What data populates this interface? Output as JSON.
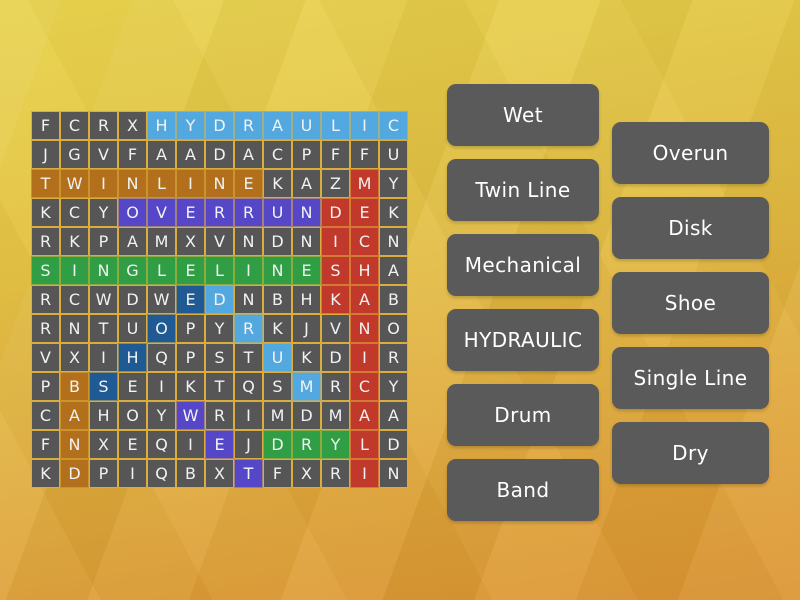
{
  "app": {
    "type": "word-search-puzzle",
    "background_top_color": "#e8d24c",
    "background_bottom_color": "#dc9432"
  },
  "grid": {
    "rows": 13,
    "cols": 13,
    "cell_background": "#565656",
    "cell_text_color": "#f2f2f2",
    "letters": [
      [
        "F",
        "C",
        "R",
        "X",
        "H",
        "Y",
        "D",
        "R",
        "A",
        "U",
        "L",
        "I",
        "C"
      ],
      [
        "J",
        "G",
        "V",
        "F",
        "A",
        "A",
        "D",
        "A",
        "C",
        "P",
        "F",
        "F",
        "U"
      ],
      [
        "T",
        "W",
        "I",
        "N",
        "L",
        "I",
        "N",
        "E",
        "K",
        "A",
        "Z",
        "M",
        "Y"
      ],
      [
        "K",
        "C",
        "Y",
        "O",
        "V",
        "E",
        "R",
        "R",
        "U",
        "N",
        "D",
        "E",
        "K"
      ],
      [
        "R",
        "K",
        "P",
        "A",
        "M",
        "X",
        "V",
        "N",
        "D",
        "N",
        "I",
        "C",
        "N"
      ],
      [
        "S",
        "I",
        "N",
        "G",
        "L",
        "E",
        "L",
        "I",
        "N",
        "E",
        "S",
        "H",
        "A"
      ],
      [
        "R",
        "C",
        "W",
        "D",
        "W",
        "E",
        "D",
        "N",
        "B",
        "H",
        "K",
        "A",
        "B"
      ],
      [
        "R",
        "N",
        "T",
        "U",
        "O",
        "P",
        "Y",
        "R",
        "K",
        "J",
        "V",
        "N",
        "O"
      ],
      [
        "V",
        "X",
        "I",
        "H",
        "Q",
        "P",
        "S",
        "T",
        "U",
        "K",
        "D",
        "I",
        "R"
      ],
      [
        "P",
        "B",
        "S",
        "E",
        "I",
        "K",
        "T",
        "Q",
        "S",
        "M",
        "R",
        "C",
        "Y"
      ],
      [
        "C",
        "A",
        "H",
        "O",
        "Y",
        "W",
        "R",
        "I",
        "M",
        "D",
        "M",
        "A",
        "A"
      ],
      [
        "F",
        "N",
        "X",
        "E",
        "Q",
        "I",
        "E",
        "J",
        "D",
        "R",
        "Y",
        "L",
        "D"
      ],
      [
        "K",
        "D",
        "P",
        "I",
        "Q",
        "B",
        "X",
        "T",
        "F",
        "X",
        "R",
        "I",
        "N"
      ]
    ],
    "highlights": [
      [
        "",
        "",
        "",
        "",
        "blue",
        "blue",
        "blue",
        "blue",
        "blue",
        "blue",
        "blue",
        "blue",
        "blue"
      ],
      [
        "",
        "",
        "",
        "",
        "",
        "",
        "",
        "",
        "",
        "",
        "",
        "",
        ""
      ],
      [
        "brown",
        "brown",
        "brown",
        "brown",
        "brown",
        "brown",
        "brown",
        "brown",
        "",
        "",
        "",
        "red",
        ""
      ],
      [
        "",
        "",
        "",
        "purple",
        "purple",
        "purple",
        "purple",
        "purple",
        "purple",
        "purple",
        "red",
        "red",
        ""
      ],
      [
        "",
        "",
        "",
        "",
        "",
        "",
        "",
        "",
        "",
        "",
        "red",
        "red",
        ""
      ],
      [
        "green",
        "green",
        "green",
        "green",
        "green",
        "green",
        "green",
        "green",
        "green",
        "green",
        "red",
        "red",
        ""
      ],
      [
        "",
        "",
        "",
        "",
        "",
        "navy",
        "blue",
        "",
        "",
        "",
        "red",
        "red",
        ""
      ],
      [
        "",
        "",
        "",
        "",
        "navy",
        "",
        "",
        "blue",
        "",
        "",
        "",
        "red",
        ""
      ],
      [
        "",
        "",
        "",
        "navy",
        "",
        "",
        "",
        "",
        "blue",
        "",
        "",
        "red",
        ""
      ],
      [
        "",
        "brown",
        "navy",
        "",
        "",
        "",
        "",
        "",
        "",
        "blue",
        "",
        "red",
        ""
      ],
      [
        "",
        "brown",
        "",
        "",
        "",
        "purple",
        "",
        "",
        "",
        "",
        "",
        "red",
        ""
      ],
      [
        "",
        "brown",
        "",
        "",
        "",
        "",
        "purple",
        "",
        "green",
        "green",
        "green",
        "red",
        ""
      ],
      [
        "",
        "brown",
        "",
        "",
        "",
        "",
        "",
        "purple",
        "",
        "",
        "",
        "red",
        ""
      ]
    ],
    "highlight_colors": {
      "blue": "#53a8e0",
      "brown": "#b2701c",
      "purple": "#5646c8",
      "red": "#c0392b",
      "green": "#2f9e44",
      "navy": "#1f5a94"
    }
  },
  "word_list": {
    "left_column": [
      {
        "label": "Wet",
        "found": false
      },
      {
        "label": "Twin Line",
        "found": false
      },
      {
        "label": "Mechanical",
        "found": false
      },
      {
        "label": "HYDRAULIC",
        "found": true
      },
      {
        "label": "Drum",
        "found": false
      },
      {
        "label": "Band",
        "found": false
      }
    ],
    "right_column": [
      {
        "label": "Overun",
        "found": false
      },
      {
        "label": "Disk",
        "found": false
      },
      {
        "label": "Shoe",
        "found": false
      },
      {
        "label": "Single Line",
        "found": false
      },
      {
        "label": "Dry",
        "found": false
      }
    ],
    "chip_background": "#5a5a5a",
    "chip_text_color": "#ffffff"
  }
}
